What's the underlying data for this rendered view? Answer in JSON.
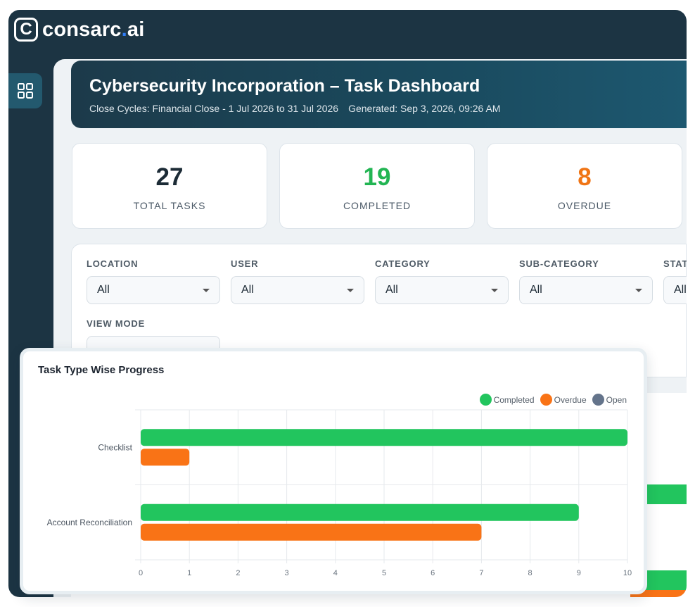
{
  "brand": {
    "logo_glyph": "C",
    "name_main": "consarc",
    "name_dot": ".",
    "name_suffix": "ai"
  },
  "sidebar": {
    "items": [
      {
        "icon": "dashboard-grid-icon",
        "active": true
      }
    ]
  },
  "header": {
    "title": "Cybersecurity Incorporation – Task Dashboard",
    "close_cycles": "Close Cycles: Financial Close - 1 Jul 2026 to 31 Jul 2026",
    "generated": "Generated: Sep 3, 2026, 09:26 AM"
  },
  "stats": [
    {
      "value": "27",
      "label": "TOTAL TASKS",
      "color": "#1c2b36"
    },
    {
      "value": "19",
      "label": "COMPLETED",
      "color": "#22b553"
    },
    {
      "value": "8",
      "label": "OVERDUE",
      "color": "#f07414"
    }
  ],
  "filters": {
    "location": {
      "label": "LOCATION",
      "value": "All"
    },
    "user": {
      "label": "USER",
      "value": "All"
    },
    "category": {
      "label": "CATEGORY",
      "value": "All"
    },
    "sub_category": {
      "label": "SUB-CATEGORY",
      "value": "All"
    },
    "status": {
      "label": "STAT",
      "value": "All"
    },
    "view_mode": {
      "label": "VIEW MODE"
    }
  },
  "colors": {
    "completed": "#22c55e",
    "overdue": "#f97316",
    "open": "#64748b"
  },
  "chart_data": {
    "type": "bar",
    "orientation": "horizontal",
    "title": "Task Type Wise Progress",
    "categories": [
      "Checklist",
      "Account Reconciliation"
    ],
    "series": [
      {
        "name": "Completed",
        "values": [
          10,
          9
        ],
        "color": "#22c55e"
      },
      {
        "name": "Overdue",
        "values": [
          1,
          7
        ],
        "color": "#f97316"
      },
      {
        "name": "Open",
        "values": [
          0,
          0
        ],
        "color": "#64748b"
      }
    ],
    "xlim": [
      0,
      10
    ],
    "xticks": [
      "0",
      "1",
      "2",
      "3",
      "4",
      "5",
      "6",
      "7",
      "8",
      "9",
      "10"
    ],
    "grid": true,
    "legend_position": "top-right"
  }
}
